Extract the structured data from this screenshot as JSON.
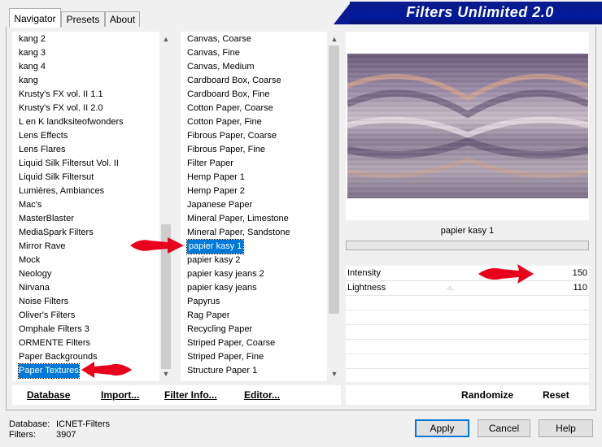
{
  "tabs": [
    {
      "label": "Navigator",
      "active": true
    },
    {
      "label": "Presets",
      "active": false
    },
    {
      "label": "About",
      "active": false
    }
  ],
  "banner_title": "Filters Unlimited 2.0",
  "categories": {
    "items": [
      "kang 2",
      "kang 3",
      "kang 4",
      "kang",
      "Krusty's FX vol. II 1.1",
      "Krusty's FX vol. II 2.0",
      "L en K landksiteofwonders",
      "Lens Effects",
      "Lens Flares",
      "Liquid Silk Filtersut Vol. II",
      "Liquid Silk Filtersut",
      "Lumières, Ambiances",
      "Mac's",
      "MasterBlaster",
      "MediaSpark Filters",
      "Mirror Rave",
      "Mock",
      "Neology",
      "Nirvana",
      "Noise Filters",
      "Oliver's Filters",
      "Omphale Filters 3",
      "ORMENTE Filters",
      "Paper Backgrounds",
      "Paper Textures"
    ],
    "selected": "Paper Textures"
  },
  "filters": {
    "items": [
      "Canvas, Coarse",
      "Canvas, Fine",
      "Canvas, Medium",
      "Cardboard Box, Coarse",
      "Cardboard Box, Fine",
      "Cotton Paper, Coarse",
      "Cotton Paper, Fine",
      "Fibrous Paper, Coarse",
      "Fibrous Paper, Fine",
      "Filter Paper",
      "Hemp Paper 1",
      "Hemp Paper 2",
      "Japanese Paper",
      "Mineral Paper, Limestone",
      "Mineral Paper, Sandstone",
      "papier kasy 1",
      "papier kasy 2",
      "papier kasy jeans 2",
      "papier kasy jeans",
      "Papyrus",
      "Rag Paper",
      "Recycling Paper",
      "Striped Paper, Coarse",
      "Striped Paper, Fine",
      "Structure Paper 1"
    ],
    "selected": "papier kasy 1"
  },
  "filter_name": "papier kasy 1",
  "params": [
    {
      "label": "Intensity",
      "value": "150"
    },
    {
      "label": "Lightness",
      "value": "110"
    }
  ],
  "toolbar": {
    "database": "Database",
    "import": "Import...",
    "filter_info": "Filter Info...",
    "editor": "Editor...",
    "randomize": "Randomize",
    "reset": "Reset"
  },
  "status": {
    "database_label": "Database:",
    "database_value": "ICNET-Filters",
    "filters_label": "Filters:",
    "filters_value": "3907"
  },
  "buttons": {
    "apply": "Apply",
    "cancel": "Cancel",
    "help": "Help"
  },
  "colors": {
    "selection": "#0078d7",
    "banner": "#0a1a94",
    "arrow": "#e8001c"
  },
  "icons": {
    "scroll_up": "chevron-up-icon",
    "scroll_down": "chevron-down-icon",
    "pointer": "red-arrow-icon"
  }
}
